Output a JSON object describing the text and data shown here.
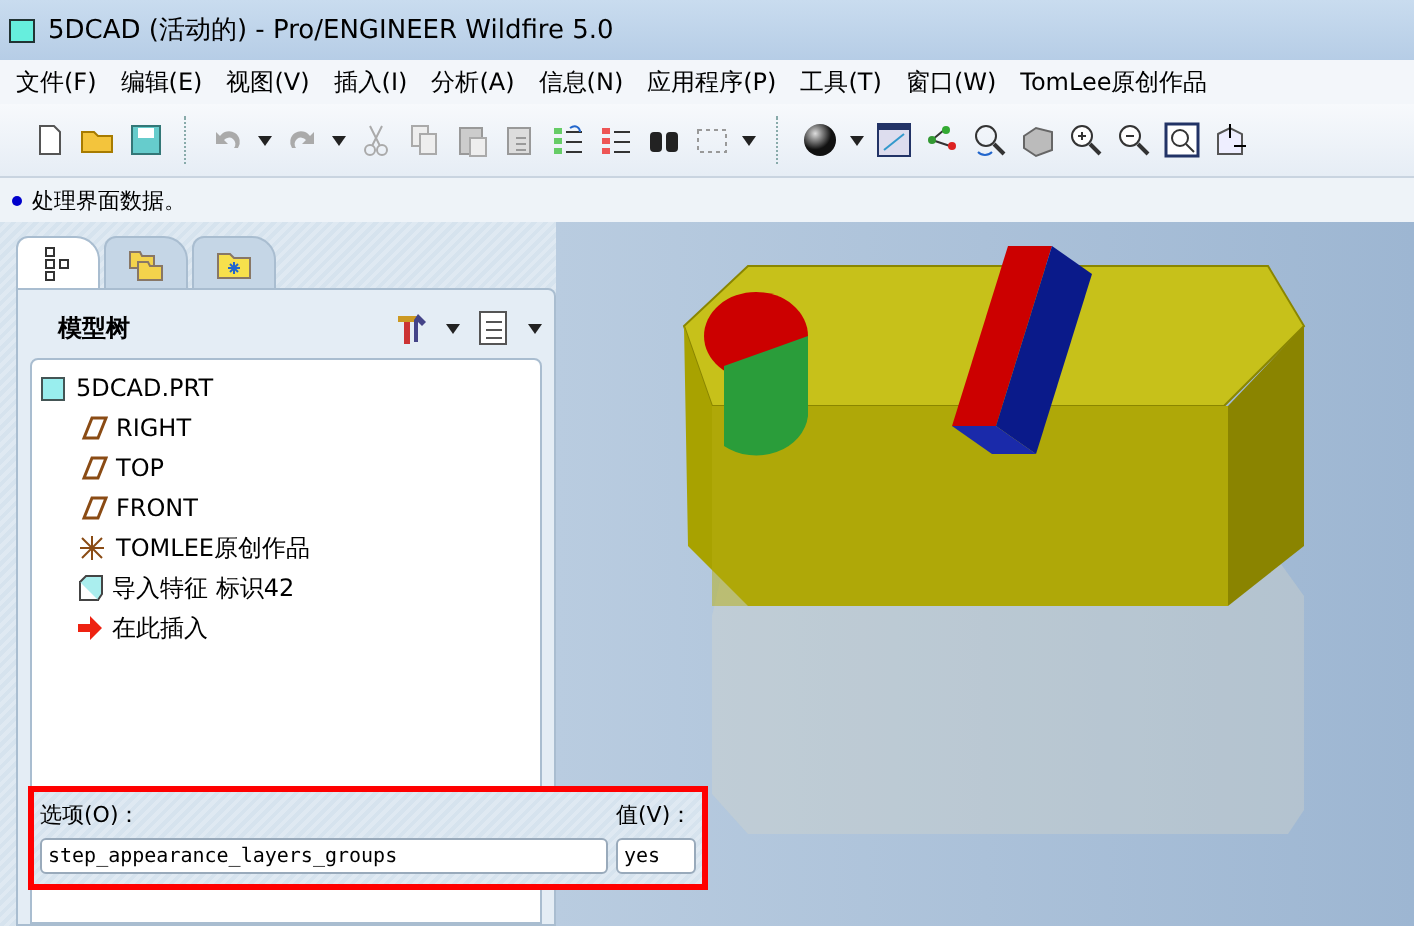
{
  "window": {
    "title": "5DCAD (活动的) - Pro/ENGINEER Wildfire 5.0"
  },
  "menu": [
    "文件(F)",
    "编辑(E)",
    "视图(V)",
    "插入(I)",
    "分析(A)",
    "信息(N)",
    "应用程序(P)",
    "工具(T)",
    "窗口(W)",
    "TomLee原创作品"
  ],
  "status_message": "处理界面数据。",
  "navigator_tabs": [
    {
      "kind": "tree",
      "selected": true
    },
    {
      "kind": "layers",
      "selected": false
    },
    {
      "kind": "favorites",
      "selected": false
    }
  ],
  "model_tree": {
    "title": "模型树",
    "root": {
      "label": "5DCAD.PRT",
      "children": [
        {
          "kind": "plane",
          "label": "RIGHT"
        },
        {
          "kind": "plane",
          "label": "TOP"
        },
        {
          "kind": "plane",
          "label": "FRONT"
        },
        {
          "kind": "csys",
          "label": "TOMLEE原创作品"
        },
        {
          "kind": "feature",
          "label": "导入特征 标识42"
        },
        {
          "kind": "insert",
          "label": "在此插入"
        }
      ]
    }
  },
  "option_dialog": {
    "option_label": "选项(O)：",
    "option_value": "step_appearance_layers_groups",
    "value_label": "值(V)：",
    "value": "yes"
  }
}
